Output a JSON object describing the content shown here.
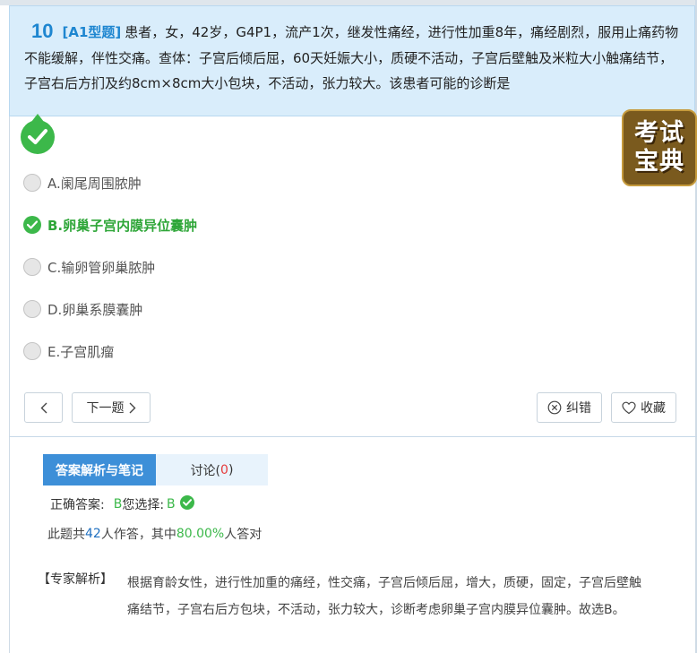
{
  "question": {
    "number": "10",
    "type": "[A1型题]",
    "text": "患者，女，42岁，G4P1，流产1次，继发性痛经，进行性加重8年，痛经剧烈，服用止痛药物不能缓解，伴性交痛。查体：子宫后倾后屈，60天妊娠大小，质硬不活动，子宫后壁触及米粒大小触痛结节，子宫右后方扪及约8cm×8cm大小包块，不活动，张力较大。该患者可能的诊断是"
  },
  "logo": {
    "line1": "考试",
    "line2": "宝典"
  },
  "options": [
    {
      "label": "A.阑尾周围脓肿",
      "state": "unselected"
    },
    {
      "label": "B.卵巢子宫内膜异位囊肿",
      "state": "correct"
    },
    {
      "label": "C.输卵管卵巢脓肿",
      "state": "unselected"
    },
    {
      "label": "D.卵巢系膜囊肿",
      "state": "unselected"
    },
    {
      "label": "E.子宫肌瘤",
      "state": "unselected"
    }
  ],
  "nav": {
    "prev_icon": "chevron-left-icon",
    "next_label": "下一题",
    "report_label": "纠错",
    "favorite_label": "收藏"
  },
  "tabs": {
    "analysis": "答案解析与笔记",
    "discuss_label": "讨论(",
    "discuss_count": "0",
    "discuss_close": ")"
  },
  "answer": {
    "correct_label": "正确答案:",
    "correct_value": "B",
    "selected_label": "您选择:",
    "selected_value": "B"
  },
  "stats": {
    "prefix": "此题共",
    "count": "42",
    "middle": "人作答，其中",
    "rate": "80.00%",
    "suffix": "人答对"
  },
  "expert": {
    "label": "【专家解析】",
    "text": "根据育龄女性，进行性加重的痛经，性交痛，子宫后倾后屈，增大，质硬，固定，子宫后壁触痛结节，子宫右后方包块，不活动，张力较大，诊断考虑卵巢子宫内膜异位囊肿。故选B。"
  },
  "colors": {
    "accent": "#1e86d0",
    "correct": "#3cb84a",
    "tab_active": "#3d8fd8",
    "question_bg": "#d9edfb"
  }
}
